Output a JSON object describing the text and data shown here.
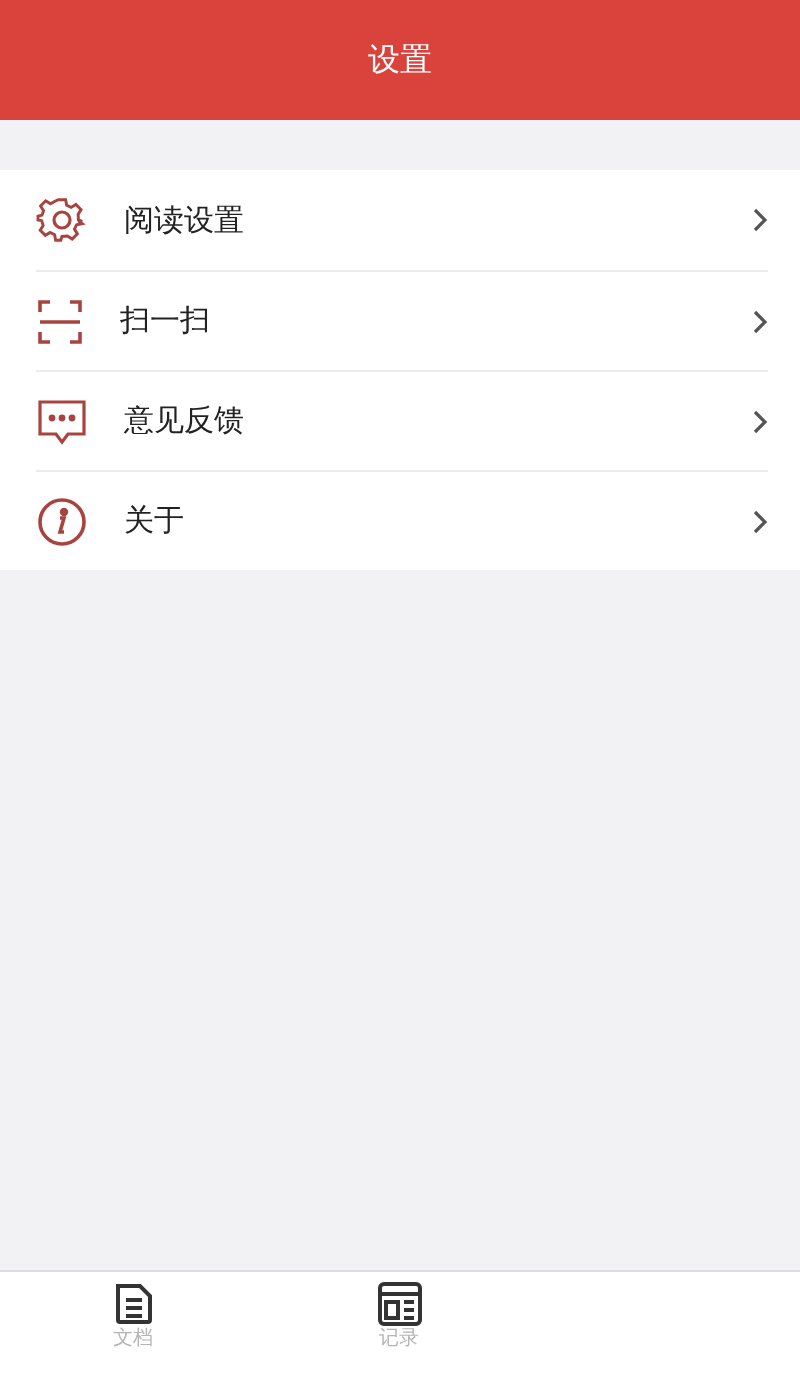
{
  "header": {
    "title": "设置"
  },
  "menu_items": [
    {
      "kind": "gear",
      "label": "阅读设置"
    },
    {
      "kind": "scan",
      "label": "扫一扫"
    },
    {
      "kind": "chat",
      "label": "意见反馈"
    },
    {
      "kind": "info",
      "label": "关于"
    }
  ],
  "tab_bar": [
    {
      "kind": "document",
      "label": "文档"
    },
    {
      "kind": "record",
      "label": "记录"
    }
  ]
}
